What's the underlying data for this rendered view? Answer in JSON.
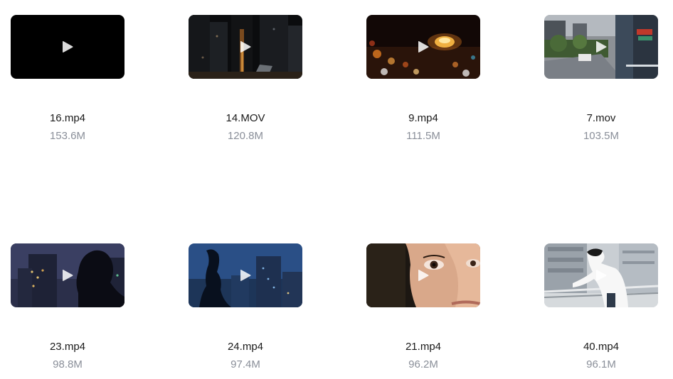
{
  "videos": [
    {
      "name": "16.mp4",
      "size": "153.6M",
      "thumbnail": "black-frame"
    },
    {
      "name": "14.MOV",
      "size": "120.8M",
      "thumbnail": "night-city-street"
    },
    {
      "name": "9.mp4",
      "size": "111.5M",
      "thumbnail": "street-lamp-bokeh"
    },
    {
      "name": "7.mov",
      "size": "103.5M",
      "thumbnail": "city-road-trees"
    },
    {
      "name": "23.mp4",
      "size": "98.8M",
      "thumbnail": "woman-silhouette-city-night"
    },
    {
      "name": "24.mp4",
      "size": "97.4M",
      "thumbnail": "woman-silhouette-blue-dusk"
    },
    {
      "name": "21.mp4",
      "size": "96.2M",
      "thumbnail": "woman-face-closeup"
    },
    {
      "name": "40.mp4",
      "size": "96.1M",
      "thumbnail": "man-leaning-railing"
    }
  ],
  "icons": {
    "play": "play-icon"
  }
}
